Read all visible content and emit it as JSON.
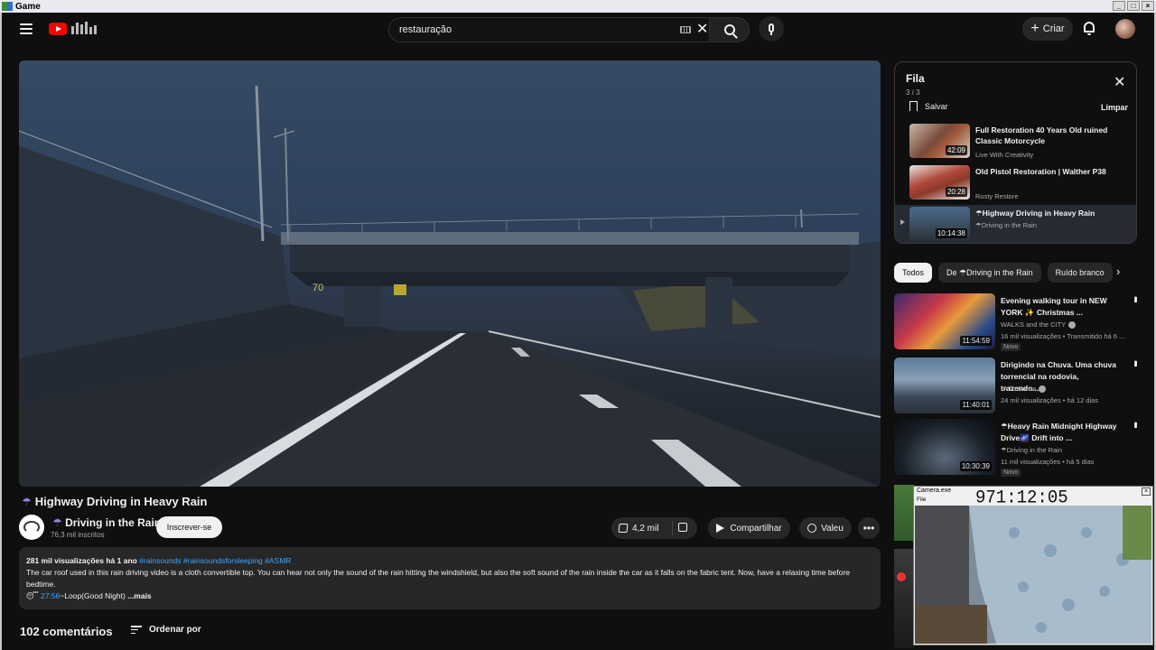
{
  "window": {
    "title": "Game",
    "controls": [
      "_",
      "□",
      "×"
    ]
  },
  "header": {
    "search": {
      "value": "restauração",
      "clear_symbol": "✕"
    },
    "create_label": "Criar",
    "icons": [
      "menu-icon",
      "youtube-logo",
      "keyboard-icon",
      "search-icon",
      "mic-icon",
      "bell-icon",
      "avatar"
    ]
  },
  "video": {
    "title": "Highway Driving in Heavy Rain",
    "title_prefix": "☂",
    "speed_sign": "70",
    "channel": {
      "name": "Driving in the Rain",
      "prefix": "☂",
      "subscribers": "76,3 mil inscritos"
    },
    "subscribe_label": "Inscrever-se",
    "likes": "4,2 mil",
    "share_label": "Compartilhar",
    "thanks_label": "Valeu",
    "more_symbol": "•••"
  },
  "description": {
    "meta": "281 mil visualizações  há 1 ano",
    "tags": "#rainsounds #rainsoundsforsleeping #ASMR",
    "text": "The car roof used in this rain driving video is a cloth convertible top. You can hear not only the sound of the rain hitting the windshield, but also the soft sound of the rain inside the car as it falls on the fabric tent. Now, have a relaxing time before bedtime.",
    "line3_emoji": "😴",
    "timestamp": "27:56",
    "line3_text": "~Loop(Good Night)",
    "more_label": " ...mais"
  },
  "comments": {
    "count_label": "102 comentários",
    "sort_label": "Ordenar por"
  },
  "queue": {
    "title": "Fila",
    "position": "3 / 3",
    "save_label": "Salvar",
    "clear_label": "Limpar",
    "close_symbol": "✕",
    "items": [
      {
        "title": "Full Restoration 40 Years Old ruined Classic Motorcycle",
        "channel": "Live With Creativity",
        "duration": "42:09"
      },
      {
        "title": "Old Pistol Restoration | Walther P38",
        "channel": "Rusty Restore",
        "duration": "20:28"
      },
      {
        "title": "☂Highway Driving in Heavy Rain",
        "channel": "☂Driving in the Rain",
        "duration": "10:14:38"
      }
    ]
  },
  "chips": [
    "Todos",
    "De ☂Driving in the Rain",
    "Ruído branco"
  ],
  "chips_next_symbol": "›",
  "recommendations": [
    {
      "title": "Evening walking tour in NEW YORK ✨ Christmas ...",
      "channel": "WALKS and the CITY",
      "verified": true,
      "stats": "16 mil visualizações • Transmitido há 6 ...",
      "badge": "Novo",
      "duration": "11:54:59"
    },
    {
      "title": "Dirigindo na Chuva. Uma chuva torrencial na rodovia, trazendo...",
      "channel": "Hello Korea",
      "verified": true,
      "stats": "24 mil visualizações • há 12 dias",
      "badge": "",
      "duration": "11:40:01"
    },
    {
      "title": "☂Heavy Rain Midnight Highway Drive🌌 Drift into ...",
      "channel": "☂Driving in the Rain",
      "verified": false,
      "stats": "11 mil visualizações • há 5 dias",
      "badge": "Novo",
      "duration": "10:30:39"
    }
  ],
  "rec_menu_symbol": "•••",
  "camera": {
    "title": "Camera.exe",
    "menu": "File",
    "timer": "971:12:05",
    "close_symbol": "×"
  },
  "colors": {
    "background": "#0f0f0f",
    "surface": "#272727",
    "accent_link": "#3ea6ff",
    "youtube_red": "#ff0000"
  }
}
